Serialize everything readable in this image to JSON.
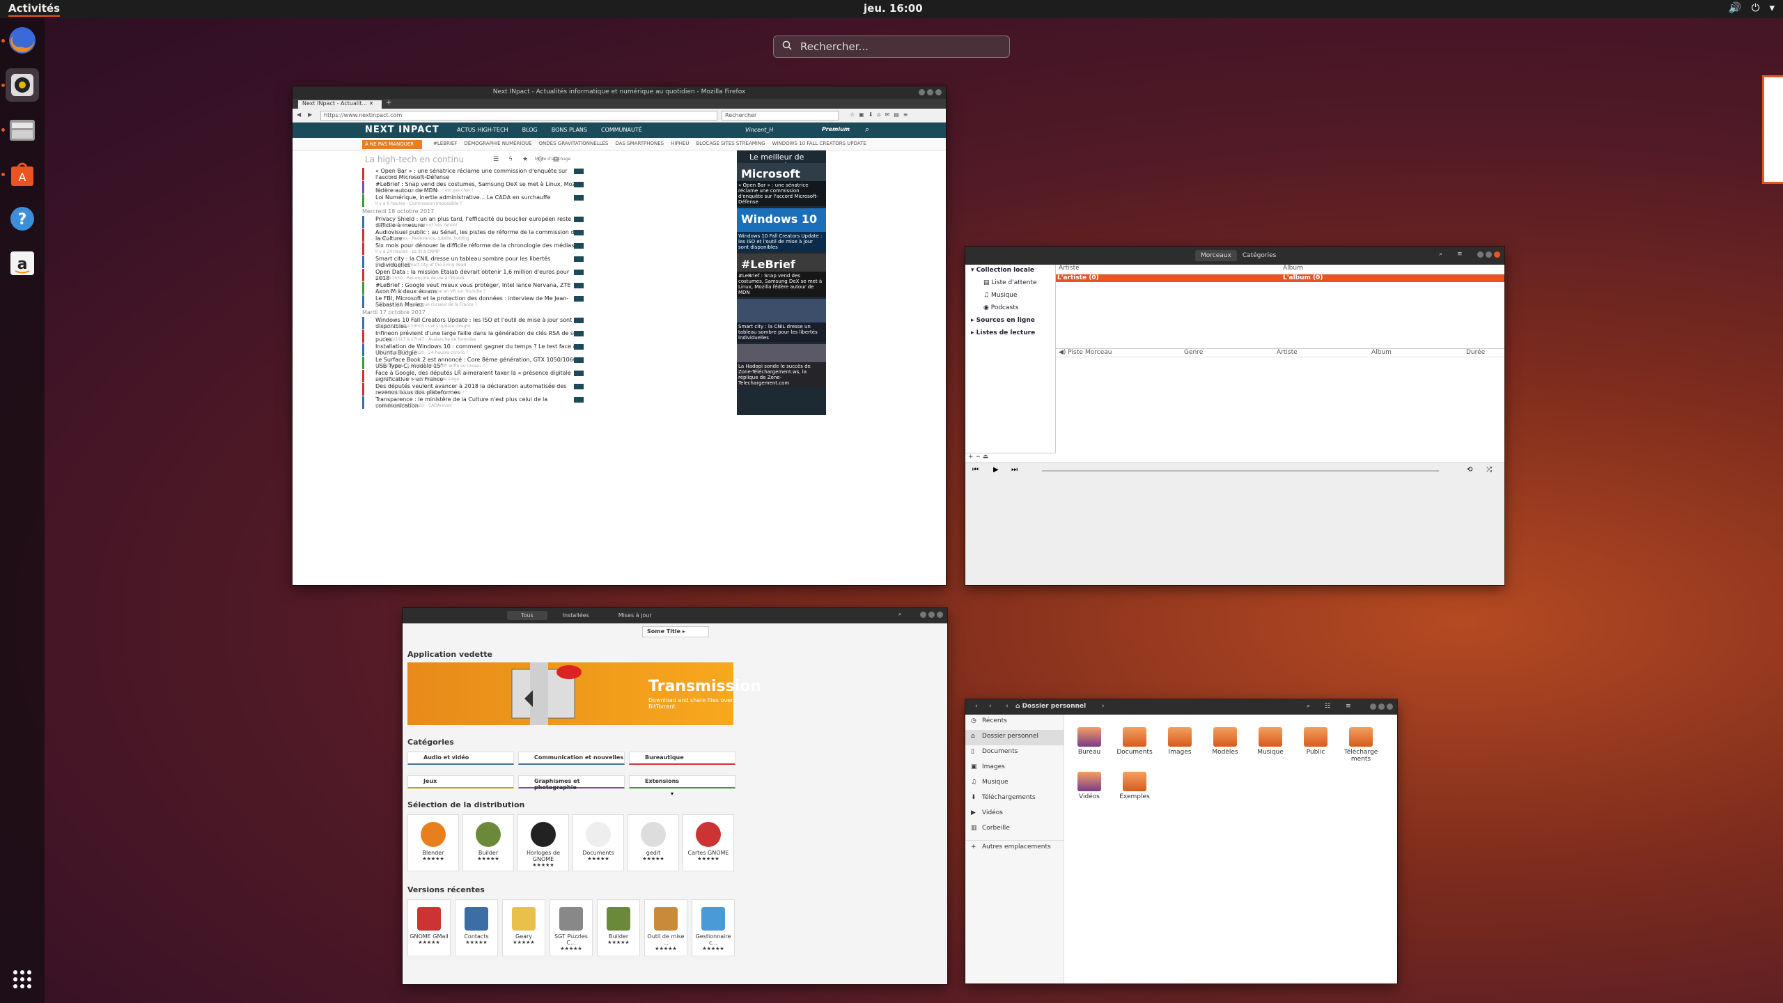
{
  "topbar": {
    "activities": "Activités",
    "clock": "jeu. 16:00"
  },
  "dock": {
    "icons": [
      "firefox-icon",
      "rhythmbox-icon",
      "files-icon",
      "software-icon",
      "help-icon",
      "amazon-icon"
    ],
    "apps_grid": "show-apps-icon"
  },
  "search": {
    "placeholder": "Rechercher..."
  },
  "firefox": {
    "title": "Next INpact - Actualités informatique et numérique au quotidien - Mozilla Firefox",
    "tab": "Next INpact - Actualit...",
    "url": "https://www.nextinpact.com",
    "search_placeholder": "Rechercher",
    "site": {
      "logo": "NEXT INPACT",
      "menu": [
        "ACTUS HIGH-TECH",
        "BLOG",
        "BONS PLANS",
        "COMMUNAUTÉ"
      ],
      "user": "Vincent_H",
      "premium": "Premium",
      "missed_button": "À NE PAS MANQUER",
      "tags": [
        "#LEBRIEF",
        "DÉMOGRAPHIE NUMÉRIQUE",
        "ONDES GRAVITATIONNELLES",
        "DAS SMARTPHONES",
        "HIPHEU",
        "BLOCAGE SITES STREAMING",
        "WINDOWS 10 FALL CREATORS UPDATE"
      ],
      "feed_title": "La high-tech en continu",
      "display_mode": "Mode d'affichage",
      "side_title": "Le meilleur de l'actualité",
      "items_top": [
        {
          "title": "« Open Bar » : une sénatrice réclame une commission d'enquête sur l'accord Microsoft-Défense",
          "sub": "Il y a 4 heures - Au armes, etc."
        },
        {
          "title": "#LeBrief : Snap vend des costumes, Samsung DeX se met à Linux, Mozilla fédère autour de MDN",
          "sub": "Il y a 4 heures - Les fake news, c'est pas cher !"
        },
        {
          "title": "Loi Numérique, inertie administrative... La CADA en surchauffe",
          "sub": "Il y a 6 heures - Commission impossible ?"
        }
      ],
      "date1": "Mercredi 18 octobre 2017",
      "items_mid": [
        {
          "title": "Privacy Shield : un an plus tard, l'efficacité du bouclier européen reste difficile à mesurer",
          "sub": "Il y a 22 heures - Un accord très Yahoo!"
        },
        {
          "title": "Audiovisuel public : au Sénat, les pistes de réforme de la commission de la Culture",
          "sub": "Il y a 24 heures - Redevance, tutelle, holding"
        },
        {
          "title": "Six mois pour dénouer la difficile réforme de la chronologie des médias",
          "sub": "Il y a 24 heures - Le lit à CNMP"
        },
        {
          "title": "Smart city : la CNIL dresse un tableau sombre pour les libertés individuelles",
          "sub": "Hier à 16h41 - Smart city of the living dead"
        },
        {
          "title": "Open Data : la mission Etalab devrait obtenir 1,6 million d'euros pour 2018",
          "sub": "Hier à 11h30 - Pas encore de vie à l'Etalab"
        },
        {
          "title": "#LeBrief : Google veut mieux vous protéger, Intel lance Nervana, ZTE Axon M à deux écrans",
          "sub": "Hier à 11h16 - Un confessionnal en VR sur Youtube ?"
        },
        {
          "title": "Le FBI, Microsoft et la protection des données : interview de Me Jean-Sébastien Mariez",
          "sub": "Hier à 10h13 - Un antique curseur de la France ?"
        }
      ],
      "date2": "Mardi 17 octobre 2017",
      "items_bot": [
        {
          "title": "Windows 10 Fall Creators Update : les ISO et l'outil de mise à jour sont disponibles",
          "sub": "Le 17/10/2017 à 19h05 - Let's update tonight"
        },
        {
          "title": "Infineon prévient d'une large faille dans la génération de clés RSA de ses puces",
          "sub": "Le 17/10/2017 à 17h47 - Avalanche de formules"
        },
        {
          "title": "Installation de Windows 10 : comment gagner du temps ? Le test face à Ubuntu Budgie",
          "sub": "Le 17/10/2017 à 17h20 - 24 heures chrono ?"
        },
        {
          "title": "Le Surface Book 2 est annoncé : Core 8ème génération, GTX 1050/1060, USB Type-C, modèle 15\"",
          "sub": "Le 17/10/2017 à 16h06 - Microsoft enfin au niveau ?"
        },
        {
          "title": "Face à Google, des députés LR aimeraient taxer la « présence digitale significative » en France",
          "sub": "Le 17/10/2017 à 15h17 - L'État de siège"
        },
        {
          "title": "Des députés veulent avancer à 2018 la déclaration automatisée des revenus issus des plateformes",
          "sub": "Le 17/10/2017 à 16h43 - CERL, c'est choi !"
        },
        {
          "title": "Transparence : le ministère de la Culture n'est plus celui de la communication",
          "sub": "Le 17/10/2017 à 13h20 - CADArevoir"
        }
      ],
      "side_cards": [
        {
          "img": "Microsoft",
          "cap": "« Open Bar » : une sénatrice réclame une commission d'enquête sur l'accord Microsoft-Défense"
        },
        {
          "img": "Windows 10",
          "cap": "Windows 10 Fall Creators Update : les ISO et l'outil de mise à jour sont disponibles"
        },
        {
          "img": "#LeBrief",
          "cap": "#LeBrief : Snap vend des costumes, Samsung DeX se met à Linux, Mozilla fédère autour de MDN"
        },
        {
          "img": "",
          "cap": "Smart city : la CNIL dresse un tableau sombre pour les libertés individuelles"
        },
        {
          "img": "",
          "cap": "La Hadopi sonde le succès de Zone-Téléchargement.ws, la réplique de Zone-Telechargement.com"
        }
      ]
    }
  },
  "rhythmbox": {
    "tabs": [
      "Morceaux",
      "Catégories"
    ],
    "sidebar": [
      "Collection locale",
      "Liste d'attente",
      "Musique",
      "Podcasts",
      "Sources en ligne",
      "Listes de lecture"
    ],
    "browser_cols": [
      "Artiste",
      "Album"
    ],
    "selected": {
      "artist": "L'artiste (0)",
      "album": "L'album (0)"
    },
    "track_cols": [
      "Piste",
      "Morceau",
      "Genre",
      "Artiste",
      "Album",
      "Durée"
    ]
  },
  "software": {
    "tabs": [
      "Tous",
      "Installées",
      "Mises à jour"
    ],
    "some_title": "Some Title",
    "featured_h": "Application vedette",
    "featured": {
      "name": "Transmission",
      "desc": "Download and share files over BitTorrent"
    },
    "categories_h": "Catégories",
    "categories": [
      "Audio et vidéo",
      "Communication et nouvelles",
      "Bureautique",
      "Jeux",
      "Graphismes et photographie",
      "Extensions"
    ],
    "distro_h": "Sélection de la distribution",
    "distro": [
      "Blender",
      "Builder",
      "Horloges de GNOME",
      "Documents",
      "gedit",
      "Cartes GNOME"
    ],
    "recent_h": "Versions récentes",
    "recent": [
      "GNOME GMail",
      "Contacts",
      "Geary",
      "SGT Puzzles C...",
      "Builder",
      "Outil de mise ...",
      "Gestionnaire c..."
    ],
    "stars": "★★★★★"
  },
  "files": {
    "path": "Dossier personnel",
    "sidebar": [
      "Récents",
      "Dossier personnel",
      "Documents",
      "Images",
      "Musique",
      "Téléchargements",
      "Vidéos",
      "Corbeille",
      "Autres emplacements"
    ],
    "folders": [
      "Bureau",
      "Documents",
      "Images",
      "Modèles",
      "Musique",
      "Public",
      "Télécharge ments",
      "Vidéos",
      "Exemples"
    ]
  }
}
